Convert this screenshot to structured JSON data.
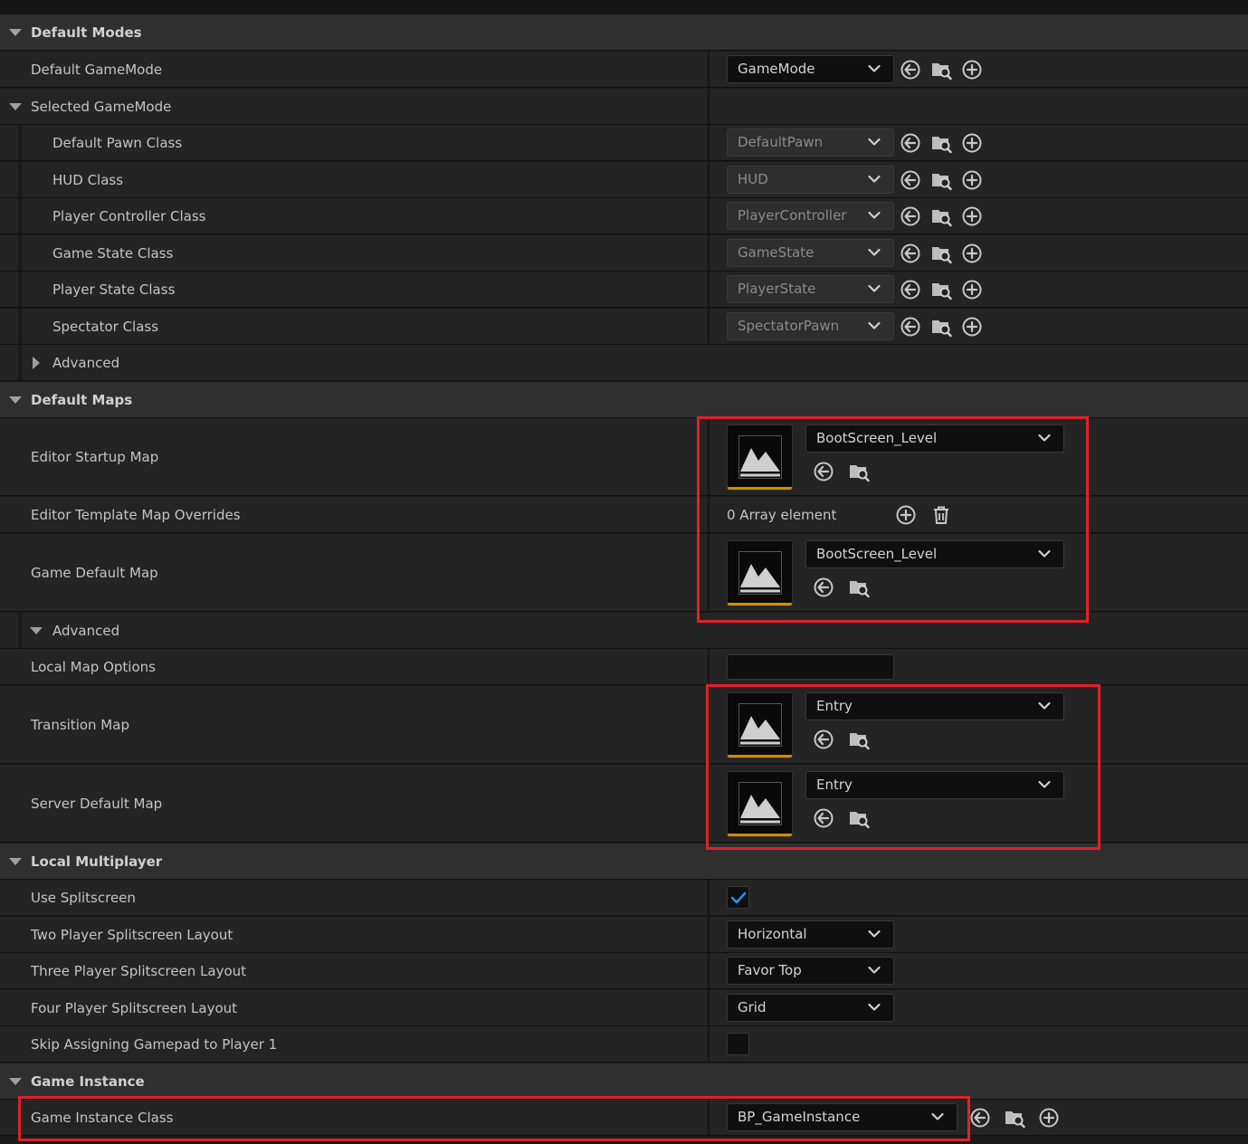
{
  "sections": {
    "default_modes": "Default Modes",
    "default_maps": "Default Maps",
    "local_multiplayer": "Local Multiplayer",
    "game_instance": "Game Instance"
  },
  "default_modes": {
    "default_gamemode_label": "Default GameMode",
    "default_gamemode_value": "GameMode",
    "selected_gamemode_label": "Selected GameMode",
    "items": [
      {
        "label": "Default Pawn Class",
        "value": "DefaultPawn"
      },
      {
        "label": "HUD Class",
        "value": "HUD"
      },
      {
        "label": "Player Controller Class",
        "value": "PlayerController"
      },
      {
        "label": "Game State Class",
        "value": "GameState"
      },
      {
        "label": "Player State Class",
        "value": "PlayerState"
      },
      {
        "label": "Spectator Class",
        "value": "SpectatorPawn"
      }
    ],
    "advanced_label": "Advanced"
  },
  "default_maps": {
    "editor_startup_label": "Editor Startup Map",
    "editor_startup_value": "BootScreen_Level",
    "template_overrides_label": "Editor Template Map Overrides",
    "template_overrides_value": "0 Array element",
    "game_default_label": "Game Default Map",
    "game_default_value": "BootScreen_Level",
    "advanced_label": "Advanced",
    "local_map_options_label": "Local Map Options",
    "transition_label": "Transition Map",
    "transition_value": "Entry",
    "server_default_label": "Server Default Map",
    "server_default_value": "Entry"
  },
  "local_multiplayer": {
    "use_splitscreen_label": "Use Splitscreen",
    "use_splitscreen_checked": true,
    "two_player_label": "Two Player Splitscreen Layout",
    "two_player_value": "Horizontal",
    "three_player_label": "Three Player Splitscreen Layout",
    "three_player_value": "Favor Top",
    "four_player_label": "Four Player Splitscreen Layout",
    "four_player_value": "Grid",
    "skip_gamepad_label": "Skip Assigning Gamepad to Player 1",
    "skip_gamepad_checked": false
  },
  "game_instance": {
    "class_label": "Game Instance Class",
    "class_value": "BP_GameInstance"
  },
  "colors": {
    "highlight": "#e0202a",
    "check": "#2a8cff",
    "thumb_bar": "#d38b00"
  }
}
